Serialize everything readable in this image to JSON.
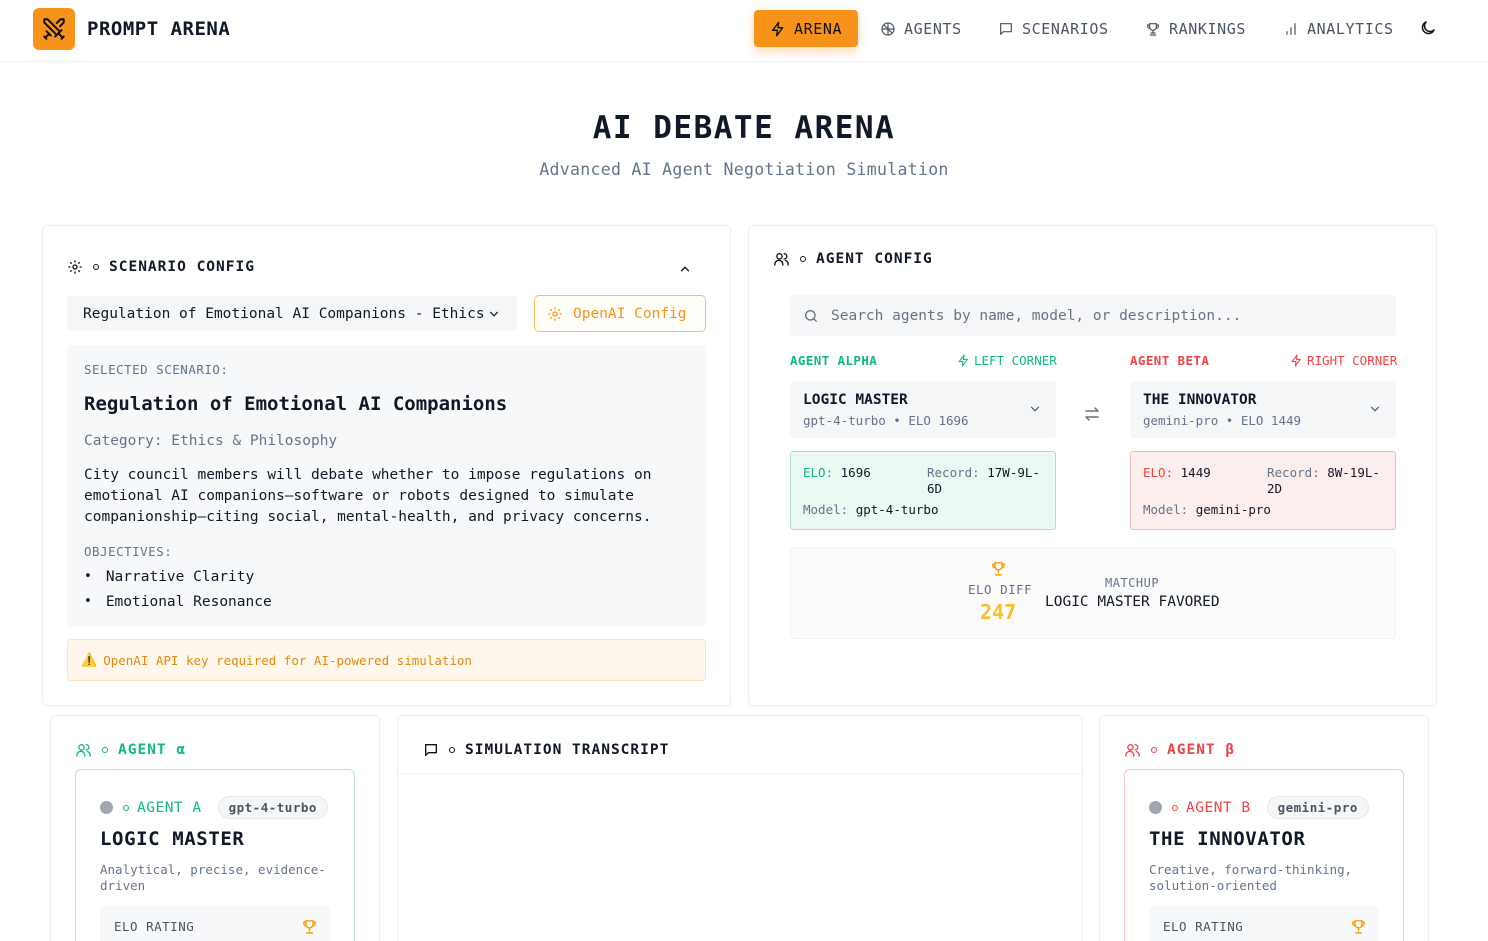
{
  "app": {
    "name": "PROMPT ARENA"
  },
  "nav": {
    "items": [
      {
        "label": "ARENA",
        "icon": "bolt-icon",
        "active": true
      },
      {
        "label": "AGENTS",
        "icon": "brain-icon",
        "active": false
      },
      {
        "label": "SCENARIOS",
        "icon": "message-square-icon",
        "active": false
      },
      {
        "label": "RANKINGS",
        "icon": "trophy-icon",
        "active": false
      },
      {
        "label": "ANALYTICS",
        "icon": "bar-chart-icon",
        "active": false
      }
    ],
    "theme_icon": "moon-icon"
  },
  "hero": {
    "title": "AI DEBATE ARENA",
    "subtitle": "Advanced AI Agent Negotiation Simulation"
  },
  "scenario_config": {
    "heading": "SCENARIO CONFIG",
    "selected_option": "Regulation of Emotional AI Companions - Ethics",
    "openai_button": "OpenAI Config",
    "selected_label": "SELECTED SCENARIO:",
    "title": "Regulation of Emotional AI Companions",
    "category": "Category: Ethics & Philosophy",
    "description": "City council members will debate whether to impose regulations on emotional AI companions—software or robots designed to simulate companionship—citing social, mental-health, and privacy concerns.",
    "objectives_label": "OBJECTIVES:",
    "objectives": [
      "Narrative Clarity",
      "Emotional Resonance"
    ],
    "warning": "OpenAI API key required for AI-powered simulation"
  },
  "agent_config": {
    "heading": "AGENT CONFIG",
    "search_placeholder": "Search agents by name, model, or description...",
    "alpha": {
      "side_label": "AGENT ALPHA",
      "corner": "LEFT CORNER",
      "name": "LOGIC MASTER",
      "subtitle": "gpt-4-turbo • ELO 1696",
      "elo_key": "ELO:",
      "elo": "1696",
      "record_key": "Record:",
      "record": "17W-9L-6D",
      "model_key": "Model:",
      "model": "gpt-4-turbo"
    },
    "beta": {
      "side_label": "AGENT BETA",
      "corner": "RIGHT CORNER",
      "name": "THE INNOVATOR",
      "subtitle": "gemini-pro • ELO 1449",
      "elo_key": "ELO:",
      "elo": "1449",
      "record_key": "Record:",
      "record": "8W-19L-2D",
      "model_key": "Model:",
      "model": "gemini-pro"
    },
    "matchup": {
      "diff_label": "ELO DIFF",
      "diff_value": "247",
      "matchup_label": "MATCHUP",
      "matchup_value": "LOGIC MASTER FAVORED"
    }
  },
  "agent_alpha_panel": {
    "heading": "AGENT α",
    "tag": "AGENT A",
    "model": "gpt-4-turbo",
    "name": "LOGIC MASTER",
    "description": "Analytical, precise, evidence-driven",
    "elo_label": "ELO RATING"
  },
  "transcript": {
    "heading": "SIMULATION TRANSCRIPT"
  },
  "agent_beta_panel": {
    "heading": "AGENT β",
    "tag": "AGENT B",
    "model": "gemini-pro",
    "name": "THE INNOVATOR",
    "description": "Creative, forward-thinking, solution-oriented",
    "elo_label": "ELO RATING"
  },
  "colors": {
    "accent": "#f7931a",
    "alpha": "#10b981",
    "beta": "#ef4444",
    "diff": "#fbbf24"
  }
}
